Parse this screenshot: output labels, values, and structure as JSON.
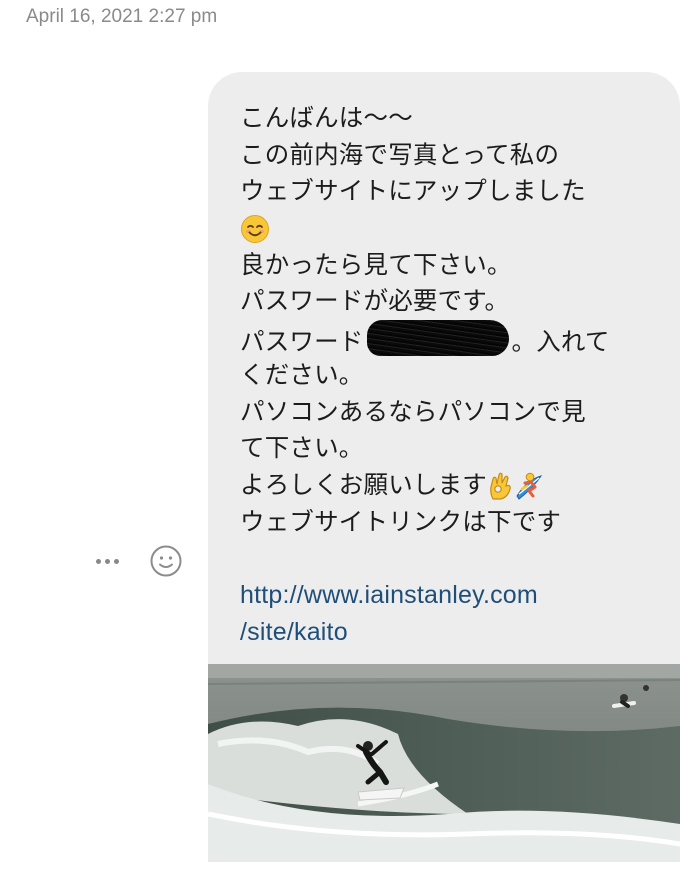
{
  "conversation": {
    "timestamp": "April 16, 2021 2:27 pm"
  },
  "message": {
    "lines": [
      "こんばんは〜〜",
      "この前内海で写真とって私の",
      "ウェブサイトにアップしました",
      "",
      "良かったら見て下さい。",
      "パスワードが必要です。",
      "パスワード",
      "。入れて",
      "ください。",
      "パソコンあるならパソコンで見",
      "て下さい。",
      "よろしくお願いします",
      "ウェブサイトリンクは下です"
    ],
    "emojis": [
      "smiling-face-emoji",
      "ok-hand-emoji",
      "surfer-emoji"
    ],
    "link_line1": "http://www.iainstanley.com",
    "link_line2": "/site/kaito",
    "attachment": "surf-photo"
  },
  "actions": {
    "icons": [
      "more-options-icon",
      "react-emoji-icon"
    ]
  }
}
